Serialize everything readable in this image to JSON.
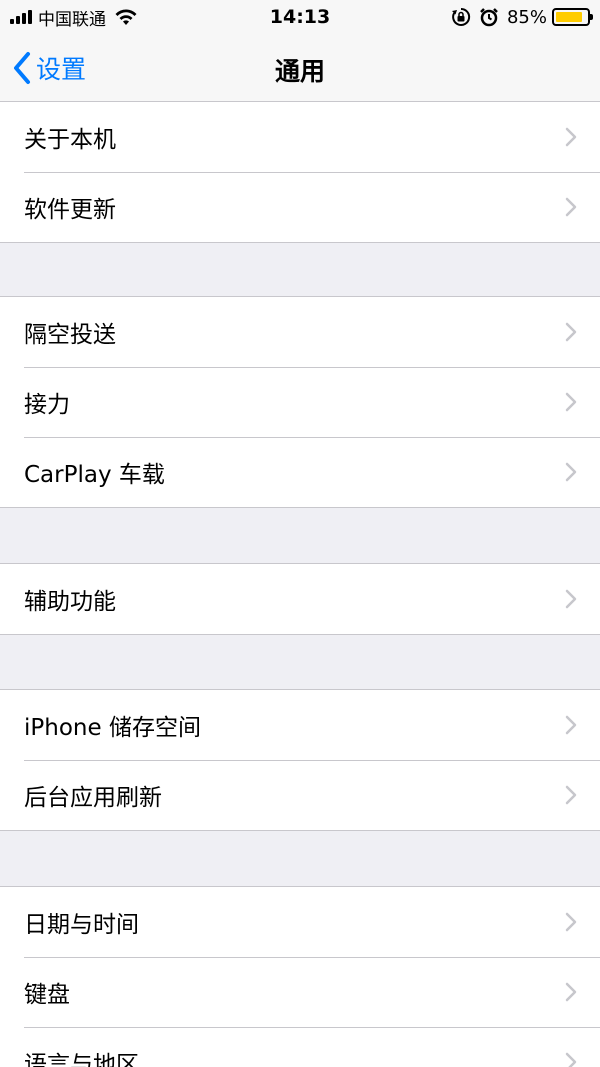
{
  "status_bar": {
    "carrier": "中国联通",
    "time": "14:13",
    "battery_percent": "85%",
    "battery_level": 0.85,
    "battery_color": "#ffcc00",
    "icons": [
      "signal-icon",
      "wifi-icon",
      "orientation-lock-icon",
      "alarm-icon",
      "battery-icon"
    ]
  },
  "nav": {
    "back_label": "设置",
    "title": "通用",
    "accent_color": "#007aff"
  },
  "groups": [
    {
      "items": [
        {
          "label": "关于本机"
        },
        {
          "label": "软件更新"
        }
      ]
    },
    {
      "items": [
        {
          "label": "隔空投送"
        },
        {
          "label": "接力"
        },
        {
          "label": "CarPlay 车载"
        }
      ]
    },
    {
      "items": [
        {
          "label": "辅助功能"
        }
      ]
    },
    {
      "items": [
        {
          "label": "iPhone 储存空间"
        },
        {
          "label": "后台应用刷新"
        }
      ]
    },
    {
      "items": [
        {
          "label": "日期与时间"
        },
        {
          "label": "键盘"
        },
        {
          "label": "语言与地区"
        }
      ]
    }
  ]
}
